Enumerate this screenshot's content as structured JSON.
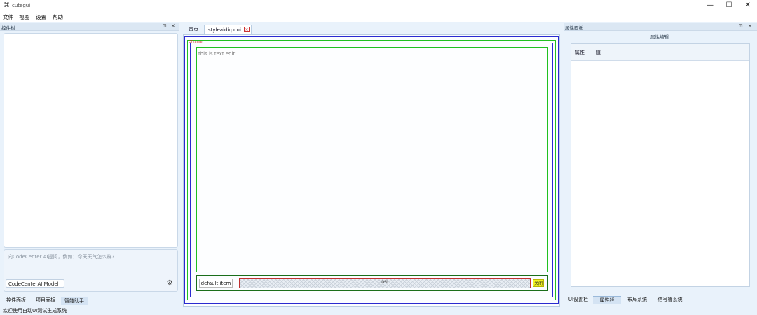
{
  "window": {
    "title": "cutegui",
    "icon": "app-icon",
    "controls": {
      "minimize": "—",
      "maximize": "☐",
      "close": "✕"
    }
  },
  "menu": [
    "文件",
    "视图",
    "设置",
    "帮助"
  ],
  "left_dock": {
    "title": "控件树",
    "float_icon": "⊡",
    "close_icon": "✕",
    "ai_placeholder": "向CodeCenter AI提问，例如：今天天气怎么样?",
    "ai_model": "CodeCenterAI Model",
    "send_icon": "⚙",
    "tabs": [
      "控件面板",
      "项目面板",
      "智能助手"
    ],
    "active_tab": 2
  },
  "center": {
    "tabs": [
      "首页",
      "styleaidiq.qui"
    ],
    "active_tab": 1,
    "close_icon": "×",
    "frame_label": "QFrame",
    "textedit_text": "this is text edit",
    "combo_value": "default item",
    "progress_text": "0%",
    "progress_value": 0,
    "ok_button": "关闭"
  },
  "right_dock": {
    "title": "属性面板",
    "float_icon": "⊡",
    "close_icon": "✕",
    "group_title": "属性编辑",
    "columns": [
      "属性",
      "值"
    ],
    "tabs": [
      "UI设置栏",
      "属性栏",
      "布局系统",
      "信号槽系统"
    ],
    "active_tab": 1
  },
  "status": "欢迎使用自动UI测试生成系统",
  "colors": {
    "background": "#e9f2fb",
    "frame_blue": "#2a2ad0",
    "frame_green": "#20c020",
    "progress_border": "#c03030",
    "button_yellow": "#f3f320"
  }
}
